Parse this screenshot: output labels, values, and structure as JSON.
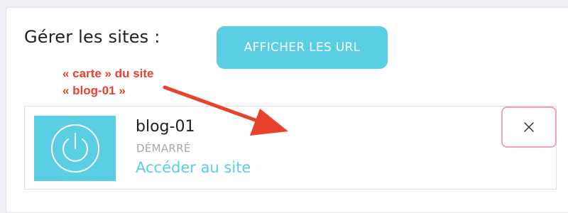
{
  "manage": {
    "title": "Gérer les sites :",
    "show_urls_label": "AFFICHER LES URL"
  },
  "annotation": {
    "line1": "« carte » du site",
    "line2": "« blog-01 »"
  },
  "site_card": {
    "name": "blog-01",
    "status": "DÉMARRÉ",
    "link_label": "Accéder au site",
    "thumb_icon": "power-icon",
    "close_icon": "close-icon"
  },
  "colors": {
    "accent": "#5acfe4",
    "annotation": "#e8422e",
    "close_border": "#f1a6b5",
    "status": "#a5a9ad"
  }
}
